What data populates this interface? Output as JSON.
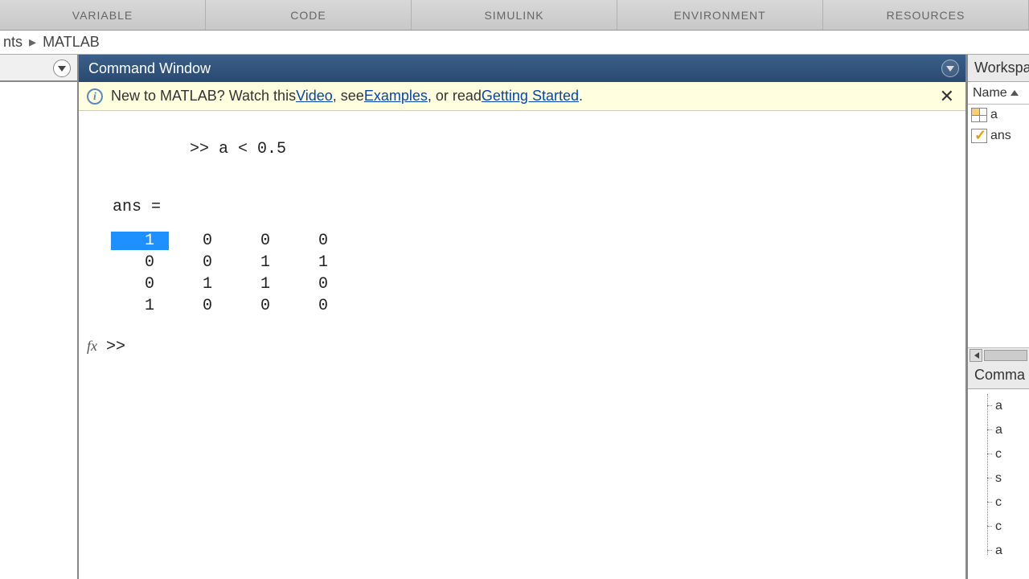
{
  "toolstrip": {
    "groups": [
      "VARIABLE",
      "CODE",
      "SIMULINK",
      "ENVIRONMENT",
      "RESOURCES"
    ]
  },
  "address": {
    "prefix": "nts",
    "folder": "MATLAB"
  },
  "command_window": {
    "title": "Command Window",
    "info": {
      "prefix": "New to MATLAB? Watch this ",
      "video": "Video",
      "mid1": ", see ",
      "examples": "Examples",
      "mid2": ", or read ",
      "getting_started": "Getting Started",
      "suffix": "."
    },
    "input_prompt": ">>",
    "command": "a < 0.5",
    "ans_label": "ans =",
    "matrix": [
      [
        "1",
        "0",
        "0",
        "0"
      ],
      [
        "0",
        "0",
        "1",
        "1"
      ],
      [
        "0",
        "1",
        "1",
        "0"
      ],
      [
        "1",
        "0",
        "0",
        "0"
      ]
    ],
    "fx_label": "fx",
    "next_prompt": ">>"
  },
  "workspace": {
    "title": "Workspa",
    "col_name": "Name",
    "vars": [
      {
        "icon": "grid",
        "name": "a"
      },
      {
        "icon": "check",
        "name": "ans"
      }
    ]
  },
  "command_history": {
    "title": "Comma",
    "items": [
      "a",
      "a",
      "c",
      "s",
      "c",
      "c",
      "a"
    ]
  }
}
